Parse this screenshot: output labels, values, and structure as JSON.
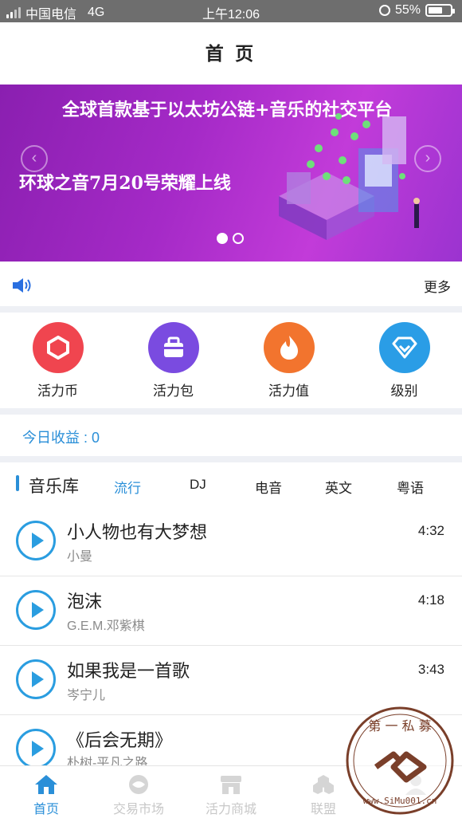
{
  "status_bar": {
    "carrier": "中国电信",
    "network": "4G",
    "time": "上午12:06",
    "battery": "55%"
  },
  "header": {
    "title": "首 页"
  },
  "banner": {
    "headline": "全球首款基于以太坊公链+音乐的社交平台",
    "subline": "环球之音7月20号荣耀上线",
    "slide_count": 2,
    "active_slide": 1
  },
  "notice": {
    "more_label": "更多"
  },
  "shortcuts": [
    {
      "label": "活力币",
      "icon": "hexagon-coin-icon",
      "color": "#f0454f"
    },
    {
      "label": "活力包",
      "icon": "bag-icon",
      "color": "#7a4be0"
    },
    {
      "label": "活力值",
      "icon": "flame-icon",
      "color": "#f2742e"
    },
    {
      "label": "级别",
      "icon": "diamond-icon",
      "color": "#2a9de6"
    }
  ],
  "earnings": {
    "text": "今日收益 : 0"
  },
  "music_library": {
    "title": "音乐库",
    "tabs": [
      "流行",
      "DJ",
      "电音",
      "英文",
      "粤语"
    ],
    "active_tab": 0,
    "songs": [
      {
        "name": "小人物也有大梦想",
        "artist": "小曼",
        "duration": "4:32"
      },
      {
        "name": "泡沫",
        "artist": "G.E.M.邓紫棋",
        "duration": "4:18"
      },
      {
        "name": "如果我是一首歌",
        "artist": "岑宁儿",
        "duration": "3:43"
      },
      {
        "name": "《后会无期》",
        "artist": "朴树-平凡之路",
        "duration": ""
      }
    ]
  },
  "tab_bar": [
    {
      "label": "首页",
      "icon": "home-icon"
    },
    {
      "label": "交易市场",
      "icon": "market-icon"
    },
    {
      "label": "活力商城",
      "icon": "store-icon"
    },
    {
      "label": "联盟",
      "icon": "alliance-icon"
    },
    {
      "label": "",
      "icon": "profile-icon"
    }
  ],
  "watermark": {
    "text": "第一私募 www.SiMu001.cn"
  },
  "colors": {
    "accent": "#2a8fd8",
    "banner": "#a52ac7"
  }
}
